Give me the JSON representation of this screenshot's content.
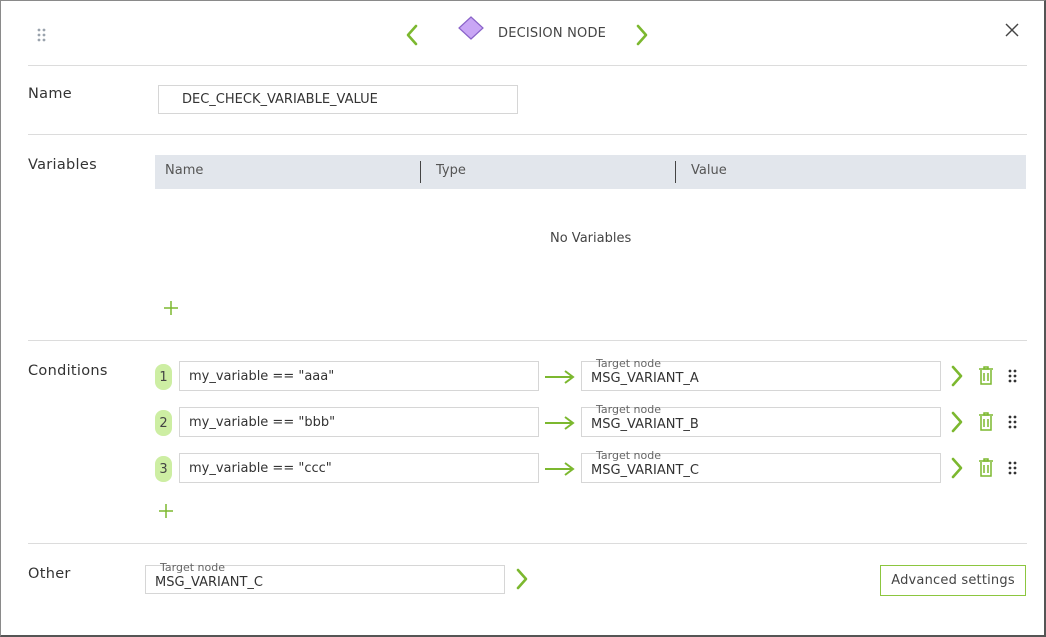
{
  "header": {
    "title": "DECISION NODE",
    "icons": {
      "drag": "drag-dots-icon",
      "prev": "chevron-left-icon",
      "next": "chevron-right-icon",
      "node": "diamond-icon",
      "close": "close-icon"
    },
    "colors": {
      "accent": "#7cb82f",
      "diamond": "#c9a6f5",
      "badge": "#cdeea3"
    }
  },
  "name_section": {
    "label": "Name",
    "value": "DEC_CHECK_VARIABLE_VALUE"
  },
  "variables_section": {
    "label": "Variables",
    "columns": [
      "Name",
      "Type",
      "Value"
    ],
    "empty_text": "No Variables"
  },
  "conditions_section": {
    "label": "Conditions",
    "target_label": "Target node",
    "rows": [
      {
        "index": "1",
        "expression": "my_variable == \"aaa\"",
        "target": "MSG_VARIANT_A"
      },
      {
        "index": "2",
        "expression": "my_variable == \"bbb\"",
        "target": "MSG_VARIANT_B"
      },
      {
        "index": "3",
        "expression": "my_variable == \"ccc\"",
        "target": "MSG_VARIANT_C"
      }
    ]
  },
  "other_section": {
    "label": "Other",
    "target_label": "Target node",
    "target": "MSG_VARIANT_C"
  },
  "advanced_button": "Advanced settings"
}
